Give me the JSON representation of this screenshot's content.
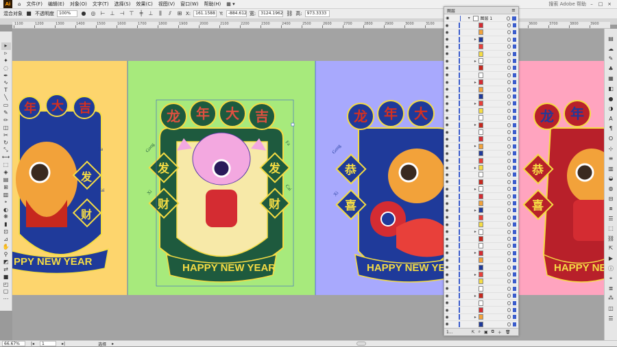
{
  "menubar": {
    "logo": "Ai",
    "items": [
      "文件(F)",
      "编辑(E)",
      "对象(O)",
      "文字(T)",
      "选择(S)",
      "效果(C)",
      "视图(V)",
      "窗口(W)",
      "帮助(H)"
    ],
    "search": "搜索 Adobe 帮助"
  },
  "controlbar": {
    "selection": "混合对象",
    "opacity_label": "不透明度",
    "opacity_value": "100%",
    "x_label": "X:",
    "x_value": "161.1588",
    "y_label": "Y:",
    "y_value": "-884.612",
    "w_label": "宽:",
    "w_value": "3124.1962",
    "h_label": "高:",
    "h_value": "973.3333"
  },
  "ruler": {
    "ticks": [
      "1100",
      "1200",
      "1300",
      "1400",
      "1500",
      "1600",
      "1700",
      "1800",
      "1900",
      "2000",
      "2100",
      "2200",
      "2300",
      "2400",
      "2500",
      "2600",
      "2700",
      "2800",
      "2900",
      "3000",
      "3100",
      "3200",
      "3300",
      "3400",
      "3500",
      "3600",
      "3700",
      "3800",
      "3900",
      "4000"
    ]
  },
  "artboards": [
    {
      "color": "#fdd56d",
      "chars": [
        "年",
        "大",
        "吉"
      ],
      "side": [
        "发",
        "财"
      ],
      "side_pinyin": [
        "Fa",
        "Cai"
      ],
      "banner": "PPY NEW YEAR"
    },
    {
      "color": "#a7ea7c",
      "chars": [
        "龙",
        "年",
        "大",
        "吉"
      ],
      "side_left": [
        "发",
        "财"
      ],
      "side_right": [
        "发",
        "财"
      ],
      "pinyin_left": [
        "Gong",
        "Xi"
      ],
      "pinyin_right": [
        "Fa",
        "Cai"
      ],
      "banner": "HAPPY NEW YEAR"
    },
    {
      "color": "#a8a9fd",
      "chars": [
        "龙",
        "年",
        "大"
      ],
      "side_left": [
        "恭",
        "喜"
      ],
      "pinyin_left": [
        "Gong",
        "Xi"
      ],
      "banner": "HAPPY NEW YEAR"
    },
    {
      "color": "#ffa4bf",
      "chars": [
        "龙",
        "年"
      ],
      "side_left": [
        "恭",
        "喜"
      ],
      "banner": "HAPPY NEW"
    }
  ],
  "layers_panel": {
    "title": "图层",
    "top_layer": "图层 1",
    "footer_count": "1..."
  },
  "statusbar": {
    "zoom": "66.67%",
    "artboard_num": "1",
    "mode": "选择"
  },
  "colors": {
    "selection_blue": "#3a5ccc",
    "banner_yellow": "#f5dc44",
    "frame_blue": "#1f3a9a"
  }
}
